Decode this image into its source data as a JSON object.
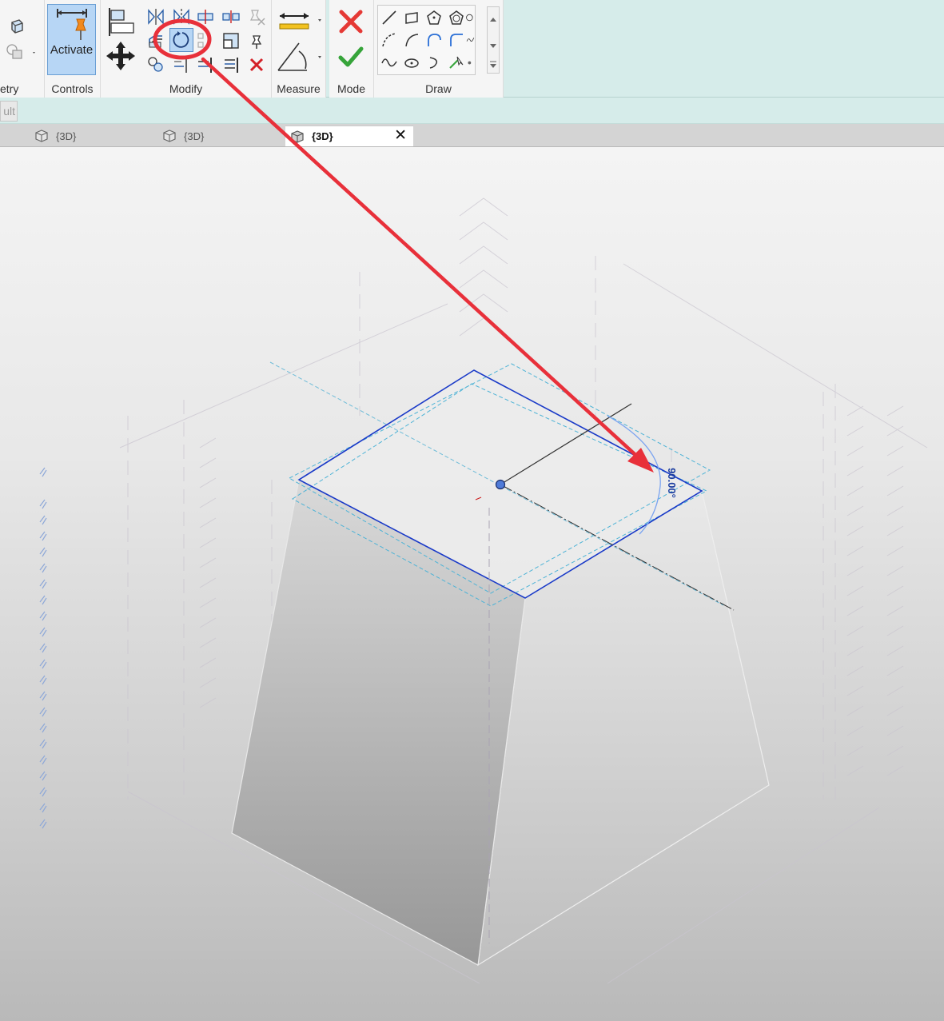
{
  "ribbon": {
    "panels": {
      "geometry_partial": "etry",
      "controls": "Controls",
      "modify": "Modify",
      "measure": "Measure",
      "mode": "Mode",
      "draw": "Draw"
    },
    "activate_label": "Activate",
    "highlight_color": "#e8303a",
    "accent_color": "#b7d6f5"
  },
  "options_bar": {
    "partial_text": "ult"
  },
  "view_tabs": [
    {
      "label": "{3D}",
      "active": false
    },
    {
      "label": "{3D}",
      "active": false
    },
    {
      "label": "{3D}",
      "active": true
    }
  ],
  "viewport": {
    "angle_dimension": "90.00°",
    "sketch_color": "#1a3ac8"
  }
}
